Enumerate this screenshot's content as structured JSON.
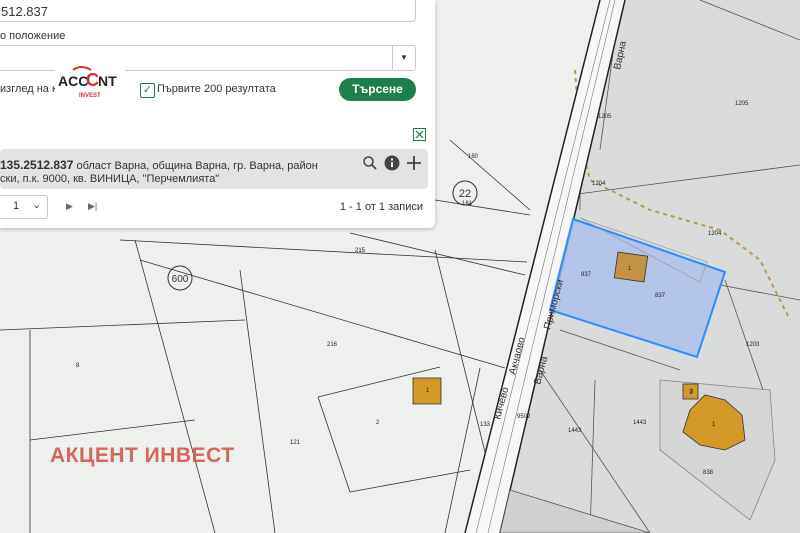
{
  "search": {
    "coordinate_value": "512.837"
  },
  "position": {
    "label": "о положение",
    "select_value": ""
  },
  "options": {
    "view_label": "изглед на к",
    "first200_label": "Първите 200 резултата",
    "first200_checked": true,
    "search_button": "Търсене"
  },
  "logo": {
    "text_a": "ACC",
    "text_b": "NT",
    "sub": "INVEST"
  },
  "result": {
    "id": "135.2512.837",
    "address_line1": "област Варна, община Варна, гр. Варна, район",
    "address_line2": "ски, п.к. 9000, кв. ВИНИЦА, \"Перчемлията\""
  },
  "pager": {
    "page": "1",
    "summary": "1 - 1 от 1 записи"
  },
  "map": {
    "watermark": "АКЦЕНТ ИНВЕСТ",
    "street_labels": [
      "Варна",
      "Кичево",
      "Акчаово",
      "Варна",
      "Приморски"
    ],
    "zone_labels": [
      "600",
      "22"
    ],
    "parcel_numbers": [
      "1205",
      "1205",
      "1204",
      "1204",
      "160",
      "161",
      "215",
      "216",
      "8",
      "121",
      "2",
      "133",
      "837",
      "837",
      "1203",
      "1443",
      "1443",
      "838",
      "9502",
      "3"
    ],
    "building_labels": [
      "1",
      "1",
      "1",
      "3"
    ],
    "selected_parcel": "837"
  },
  "colors": {
    "accent": "#1e7e4c",
    "selection_fill": "#aabfea",
    "selection_border": "#2e8bff",
    "building": "#d39a2a",
    "watermark": "#d4574e"
  }
}
